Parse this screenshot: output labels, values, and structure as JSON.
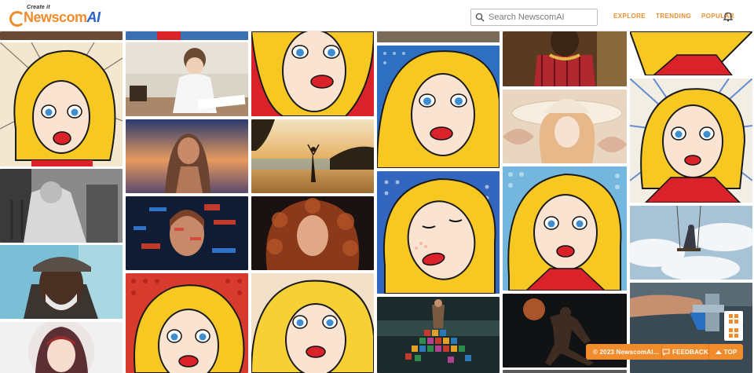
{
  "brand": {
    "tagline": "Create it",
    "name_main": "Newscom",
    "name_accent": "AI",
    "accent_color": "#f08c2c",
    "ai_color": "#2a62c9"
  },
  "search": {
    "placeholder": "Search NewscomAI",
    "value": ""
  },
  "nav": {
    "explore": "EXPLORE",
    "trending": "TRENDING",
    "popular": "POPULAR"
  },
  "footer": {
    "copyright": "© 2023 NewscomAI...",
    "feedback": "FEEDBACK",
    "top": "TOP"
  },
  "gallery": {
    "images": [
      {
        "subject": "pop-art-woman"
      },
      {
        "subject": "boy-writing"
      },
      {
        "subject": "elderly-woman-rocking-chair"
      },
      {
        "subject": "elderly-man-portrait"
      },
      {
        "subject": "hooded-girl-illustration"
      },
      {
        "subject": "woman-sunset-portrait"
      },
      {
        "subject": "glitch-woman-portrait"
      },
      {
        "subject": "pop-art-woman"
      },
      {
        "subject": "beach-silhouette"
      },
      {
        "subject": "curly-hair-woman"
      },
      {
        "subject": "pop-art-woman"
      },
      {
        "subject": "pop-art-woman"
      },
      {
        "subject": "pop-art-woman-eyes-closed"
      },
      {
        "subject": "woman-colorful-dress"
      },
      {
        "subject": "tribal-man"
      },
      {
        "subject": "woman-white-hat"
      },
      {
        "subject": "pop-art-woman"
      },
      {
        "subject": "basketball-player"
      },
      {
        "subject": "pop-art-woman"
      },
      {
        "subject": "swing-clouds"
      },
      {
        "subject": "faucet-hand"
      }
    ]
  }
}
